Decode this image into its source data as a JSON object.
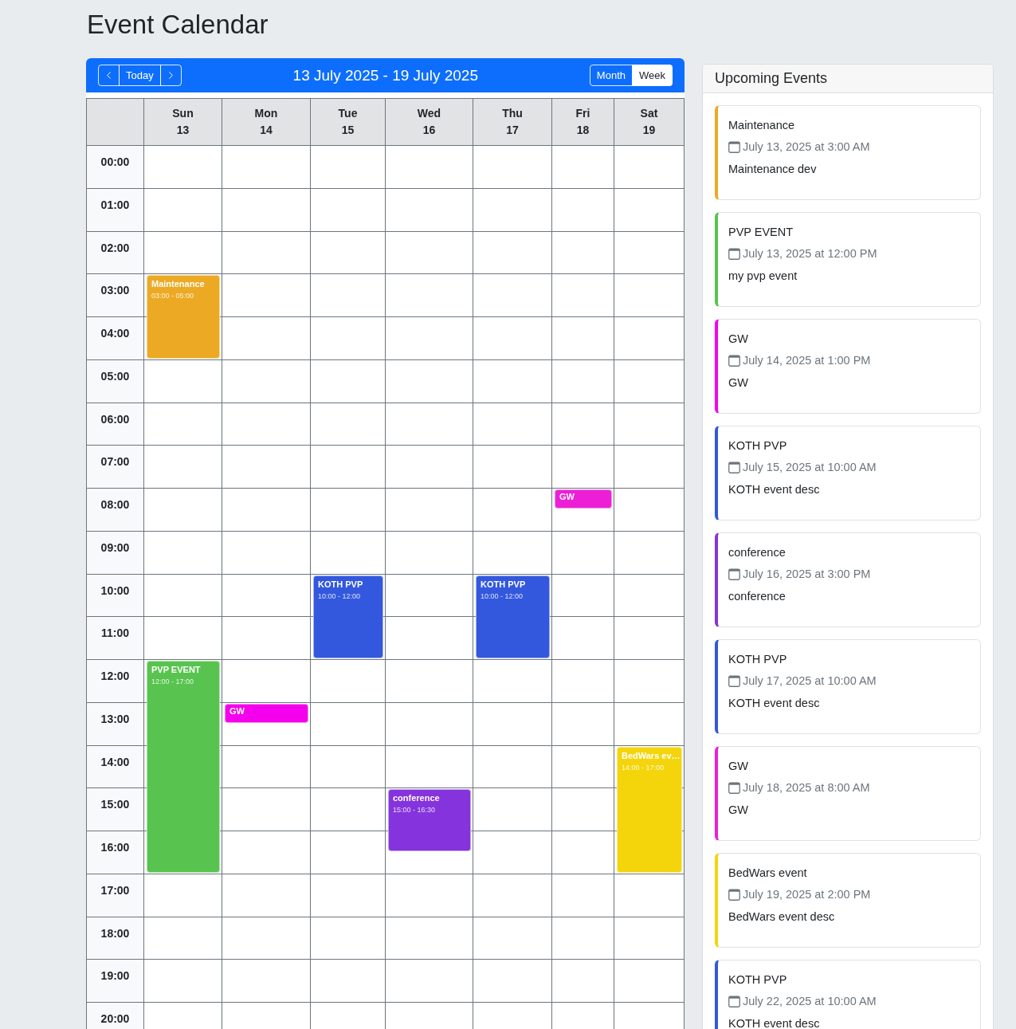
{
  "page": {
    "title": "Event Calendar"
  },
  "calendar": {
    "today_label": "Today",
    "range_title": "13 July 2025 - 19 July 2025",
    "views": [
      {
        "label": "Month",
        "selected": false
      },
      {
        "label": "Week",
        "selected": true
      }
    ],
    "days": [
      {
        "name": "Sun",
        "date": "13"
      },
      {
        "name": "Mon",
        "date": "14"
      },
      {
        "name": "Tue",
        "date": "15"
      },
      {
        "name": "Wed",
        "date": "16"
      },
      {
        "name": "Thu",
        "date": "17"
      },
      {
        "name": "Fri",
        "date": "18"
      },
      {
        "name": "Sat",
        "date": "19"
      }
    ],
    "rows": [
      {
        "label": "00:00",
        "cells": [
          {},
          {},
          {},
          {},
          {},
          {},
          {}
        ]
      },
      {
        "label": "01:00",
        "cells": [
          {},
          {},
          {},
          {},
          {},
          {},
          {}
        ]
      },
      {
        "label": "02:00",
        "cells": [
          {},
          {},
          {},
          {},
          {},
          {},
          {}
        ]
      },
      {
        "label": "03:00",
        "cells": [
          {
            "events": [
              {
                "kind": "block",
                "title": "Maintenance",
                "time": "03:00 - 05:00",
                "color": "#ecaa24"
              }
            ]
          },
          {},
          {},
          {},
          {},
          {},
          {}
        ]
      },
      {
        "label": "04:00",
        "cells": [
          {},
          {},
          {},
          {},
          {},
          {},
          {}
        ]
      },
      {
        "label": "05:00",
        "cells": [
          {},
          {},
          {},
          {},
          {},
          {},
          {}
        ]
      },
      {
        "label": "06:00",
        "cells": [
          {},
          {},
          {},
          {},
          {},
          {},
          {}
        ]
      },
      {
        "label": "07:00",
        "cells": [
          {},
          {},
          {},
          {},
          {},
          {},
          {}
        ]
      },
      {
        "label": "08:00",
        "cells": [
          {},
          {},
          {},
          {},
          {},
          {
            "events": [
              {
                "kind": "short",
                "title": "GW",
                "color": "#ec1fd6"
              }
            ]
          },
          {}
        ]
      },
      {
        "label": "09:00",
        "cells": [
          {},
          {},
          {},
          {},
          {},
          {},
          {}
        ]
      },
      {
        "label": "10:00",
        "cells": [
          {},
          {},
          {
            "events": [
              {
                "kind": "block",
                "title": "KOTH PVP",
                "time": "10:00 - 12:00",
                "color": "#3358de"
              }
            ]
          },
          {},
          {
            "events": [
              {
                "kind": "block",
                "title": "KOTH PVP",
                "time": "10:00 - 12:00",
                "color": "#3358de"
              }
            ]
          },
          {},
          {}
        ]
      },
      {
        "label": "11:00",
        "cells": [
          {},
          {},
          {},
          {},
          {},
          {},
          {}
        ]
      },
      {
        "label": "12:00",
        "cells": [
          {
            "events": [
              {
                "kind": "block",
                "title": "PVP EVENT",
                "time": "12:00 - 17:00",
                "color": "#58c44f"
              }
            ]
          },
          {},
          {},
          {},
          {},
          {},
          {}
        ]
      },
      {
        "label": "13:00",
        "cells": [
          {},
          {
            "events": [
              {
                "kind": "short",
                "title": "GW",
                "color": "#f500ec"
              }
            ]
          },
          {},
          {},
          {},
          {},
          {}
        ]
      },
      {
        "label": "14:00",
        "cells": [
          {},
          {},
          {},
          {},
          {},
          {},
          {
            "events": [
              {
                "kind": "block",
                "title": "BedWars ev…",
                "time": "14:00 - 17:00",
                "color": "#f4d50c"
              }
            ]
          }
        ]
      },
      {
        "label": "15:00",
        "cells": [
          {},
          {},
          {},
          {
            "events": [
              {
                "kind": "block",
                "title": "conference",
                "time": "15:00 - 16:30",
                "color": "#8533dd"
              }
            ]
          },
          {},
          {},
          {}
        ]
      },
      {
        "label": "16:00",
        "cells": [
          {},
          {},
          {},
          {},
          {},
          {},
          {}
        ]
      },
      {
        "label": "17:00",
        "cells": [
          {},
          {},
          {},
          {},
          {},
          {},
          {}
        ]
      },
      {
        "label": "18:00",
        "cells": [
          {},
          {},
          {},
          {},
          {},
          {},
          {}
        ]
      },
      {
        "label": "19:00",
        "cells": [
          {},
          {},
          {},
          {},
          {},
          {},
          {}
        ]
      },
      {
        "label": "20:00",
        "cells": [
          {},
          {},
          {},
          {},
          {},
          {},
          {}
        ]
      }
    ]
  },
  "upcoming": {
    "title": "Upcoming Events",
    "events": [
      {
        "title": "Maintenance",
        "date": "July 13, 2025 at 3:00 AM",
        "description": "Maintenance dev",
        "color": "#ecaa24"
      },
      {
        "title": "PVP EVENT",
        "date": "July 13, 2025 at 12:00 PM",
        "description": "my pvp event",
        "color": "#58c44f"
      },
      {
        "title": "GW",
        "date": "July 14, 2025 at 1:00 PM",
        "description": "GW",
        "color": "#f500ec"
      },
      {
        "title": "KOTH PVP",
        "date": "July 15, 2025 at 10:00 AM",
        "description": "KOTH event desc",
        "color": "#3358de"
      },
      {
        "title": "conference",
        "date": "July 16, 2025 at 3:00 PM",
        "description": "conference",
        "color": "#8533dd"
      },
      {
        "title": "KOTH PVP",
        "date": "July 17, 2025 at 10:00 AM",
        "description": "KOTH event desc",
        "color": "#3358de"
      },
      {
        "title": "GW",
        "date": "July 18, 2025 at 8:00 AM",
        "description": "GW",
        "color": "#ec1fd6"
      },
      {
        "title": "BedWars event",
        "date": "July 19, 2025 at 2:00 PM",
        "description": "BedWars event desc",
        "color": "#f4d50c"
      },
      {
        "title": "KOTH PVP",
        "date": "July 22, 2025 at 10:00 AM",
        "description": "KOTH event desc",
        "color": "#3358de"
      }
    ]
  }
}
